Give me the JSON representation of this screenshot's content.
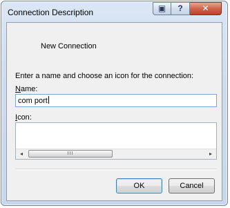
{
  "window": {
    "title": "Connection Description",
    "controls": {
      "context_help": "▣",
      "help": "?",
      "close": "✕"
    }
  },
  "dialog": {
    "connection_name": "New Connection",
    "instructions": "Enter a name and choose an icon for the connection:",
    "name_label": "Name:",
    "name_value": "com port",
    "icon_label": "Icon:",
    "scroll_left": "◂",
    "scroll_right": "▸",
    "scroll_thumb_grip": "III",
    "ok_label": "OK",
    "cancel_label": "Cancel"
  },
  "colors": {
    "close_button": "#c0402a",
    "input_border": "#7ea4d2",
    "default_button_border": "#3c7fb1"
  }
}
